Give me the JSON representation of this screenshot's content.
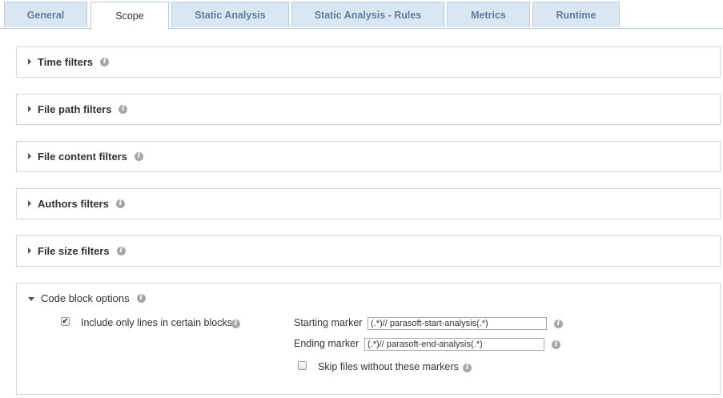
{
  "tabs": [
    {
      "label": "General",
      "active": false
    },
    {
      "label": "Scope",
      "active": true
    },
    {
      "label": "Static Analysis",
      "active": false
    },
    {
      "label": "Static Analysis - Rules",
      "active": false
    },
    {
      "label": "Metrics",
      "active": false
    },
    {
      "label": "Runtime",
      "active": false
    }
  ],
  "panels": {
    "time": {
      "title": "Time filters",
      "expanded": false
    },
    "file_path": {
      "title": "File path filters",
      "expanded": false
    },
    "file_content": {
      "title": "File content filters",
      "expanded": false
    },
    "authors": {
      "title": "Authors filters",
      "expanded": false
    },
    "file_size": {
      "title": "File size filters",
      "expanded": false
    },
    "code_block": {
      "title": "Code block options",
      "expanded": true,
      "include_only_lines": {
        "label": "Include only lines in certain blocks",
        "checked": true
      },
      "starting_marker": {
        "label": "Starting marker",
        "value": "(.*)// parasoft-start-analysis(.*)"
      },
      "ending_marker": {
        "label": "Ending marker",
        "value": "(.*)// parasoft-end-analysis(.*)"
      },
      "skip_files": {
        "label": "Skip files without these markers",
        "checked": false
      }
    }
  },
  "icons": {
    "info": "info-icon",
    "collapsed": "caret-right-icon",
    "expanded": "caret-down-icon"
  },
  "colors": {
    "tab_bg": "#dae7f2",
    "tab_text": "#5d7f9e",
    "border": "#b7cde0"
  }
}
